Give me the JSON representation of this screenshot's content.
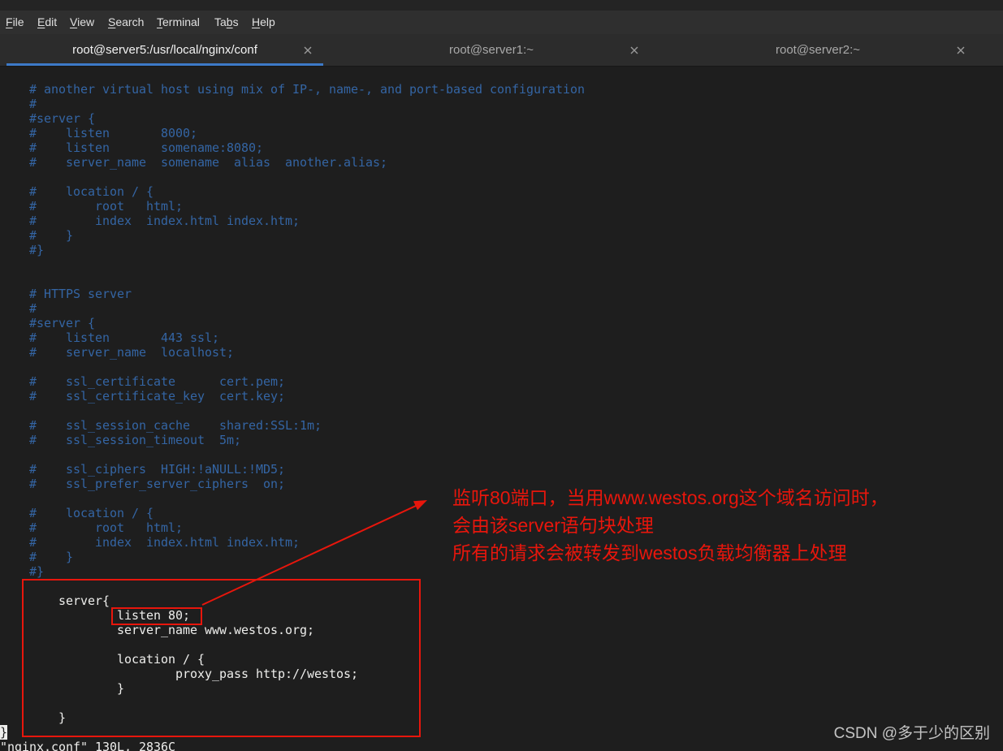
{
  "colors": {
    "terminal_background": "#1e1e1e",
    "comment": "#3465a4",
    "foreground": "#eeeeec",
    "tab_accent": "#3d7ac8",
    "annotation": "#e8160c"
  },
  "icons": {
    "tab_close": "close-icon"
  },
  "menubar": {
    "items": [
      {
        "label": "File"
      },
      {
        "label": "Edit"
      },
      {
        "label": "View"
      },
      {
        "label": "Search"
      },
      {
        "label": "Terminal"
      },
      {
        "label": "Tabs"
      },
      {
        "label": "Help"
      }
    ]
  },
  "tabs": [
    {
      "label": "root@server5:/usr/local/nginx/conf",
      "active": true
    },
    {
      "label": "root@server1:~",
      "active": false
    },
    {
      "label": "root@server2:~",
      "active": false
    }
  ],
  "terminal": {
    "lines": [
      "    # another virtual host using mix of IP-, name-, and port-based configuration",
      "    #",
      "    #server {",
      "    #    listen       8000;",
      "    #    listen       somename:8080;",
      "    #    server_name  somename  alias  another.alias;",
      "",
      "    #    location / {",
      "    #        root   html;",
      "    #        index  index.html index.htm;",
      "    #    }",
      "    #}",
      "",
      "",
      "    # HTTPS server",
      "    #",
      "    #server {",
      "    #    listen       443 ssl;",
      "    #    server_name  localhost;",
      "",
      "    #    ssl_certificate      cert.pem;",
      "    #    ssl_certificate_key  cert.key;",
      "",
      "    #    ssl_session_cache    shared:SSL:1m;",
      "    #    ssl_session_timeout  5m;",
      "",
      "    #    ssl_ciphers  HIGH:!aNULL:!MD5;",
      "    #    ssl_prefer_server_ciphers  on;",
      "",
      "    #    location / {",
      "    #        root   html;",
      "    #        index  index.html index.htm;",
      "    #    }",
      "    #}",
      "",
      "        server{",
      "                listen 80;",
      "                server_name www.westos.org;",
      "",
      "                location / {",
      "                        proxy_pass http://westos;",
      "                }",
      "",
      "        }",
      "}"
    ],
    "status_line": "\"nginx.conf\" 130L, 2836C"
  },
  "annotation": {
    "lines": [
      "监听80端口，当用www.westos.org这个域名访问时，",
      "会由该server语句块处理",
      "所有的请求会被转发到westos负载均衡器上处理"
    ]
  },
  "watermark": {
    "text": "CSDN @多于少的区别"
  }
}
